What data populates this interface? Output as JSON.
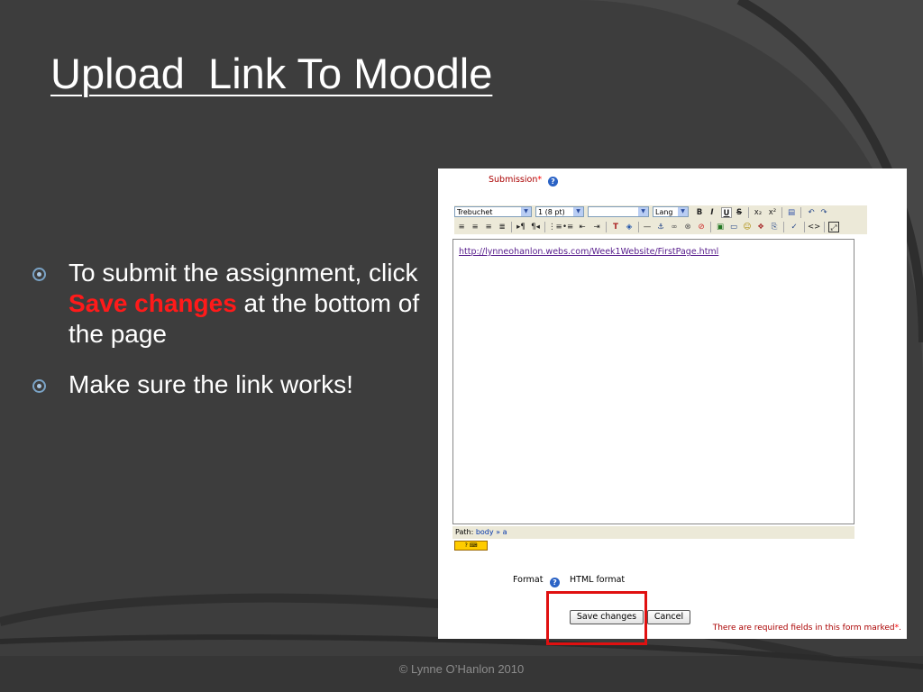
{
  "slide": {
    "title": "Upload  Link To Moodle",
    "bullets": [
      {
        "text_before": "To submit the assignment, click ",
        "highlight": "Save changes",
        "text_after": " at the bottom of the page"
      },
      {
        "text": "Make sure the link works!"
      }
    ],
    "footer": "©  Lynne O’Hanlon  2010",
    "colors": {
      "background": "#3d3d3d",
      "highlight": "#ff1a1a",
      "frame_box": "#e01010"
    }
  },
  "screenshot": {
    "submission_label": "Submission",
    "required_mark": "*",
    "toolbar": {
      "font_value": "Trebuchet",
      "size_value": "1 (8 pt)",
      "style_value": "",
      "lang_value": "Lang",
      "row1_icons": [
        "bold-icon",
        "italic-icon",
        "underline-icon",
        "strikethrough-icon",
        "subscript-icon",
        "superscript-icon",
        "clean-icon",
        "undo-icon",
        "redo-icon"
      ],
      "row2_icons": [
        "align-left-icon",
        "align-center-icon",
        "align-right-icon",
        "justify-icon",
        "ltr-icon",
        "rtl-icon",
        "ordered-list-icon",
        "unordered-list-icon",
        "outdent-icon",
        "indent-icon",
        "text-color-icon",
        "background-color-icon",
        "horizontal-rule-icon",
        "anchor-icon",
        "link-icon",
        "unlink-icon",
        "nolink-icon",
        "image-icon",
        "table-icon",
        "smiley-icon",
        "special-char-icon",
        "search-replace-icon",
        "spellcheck-icon",
        "html-source-icon",
        "fullscreen-icon"
      ]
    },
    "editor_content": "http://lynneohanlon.webs.com/Week1Website/FirstPage.html",
    "path": {
      "label": "Path:",
      "body": "body",
      "sep": "»",
      "a": "a"
    },
    "format_label": "Format",
    "format_value": "HTML format",
    "save_button": "Save changes",
    "cancel_button": "Cancel",
    "required_note": "There are required fields in this form marked",
    "required_note_mark": "*",
    "required_note_end": "."
  }
}
